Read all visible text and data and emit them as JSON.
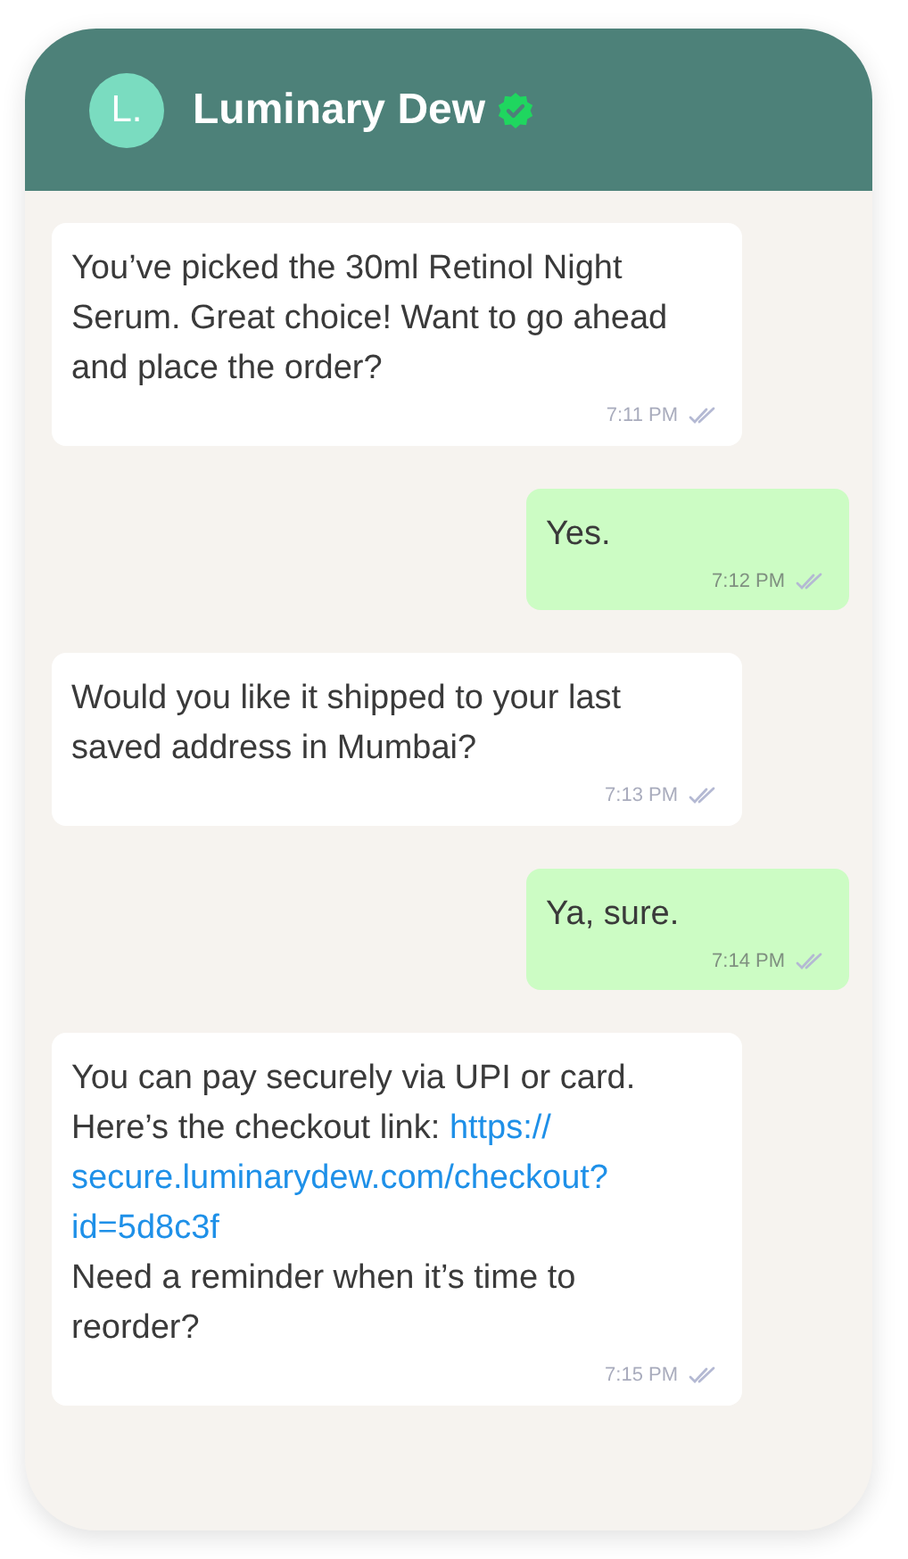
{
  "header": {
    "avatar_initial": "L.",
    "name": "Luminary Dew",
    "verified": true
  },
  "messages": [
    {
      "kind": "incoming",
      "parts": [
        {
          "kind": "text",
          "text": "You’ve picked the 30ml Retinol Night Serum. Great choice! Want to go ahead and place the order?"
        }
      ],
      "time": "7:11 PM",
      "read": true
    },
    {
      "kind": "outgoing",
      "parts": [
        {
          "kind": "text",
          "text": "Yes."
        }
      ],
      "time": "7:12 PM",
      "read": true
    },
    {
      "kind": "incoming",
      "parts": [
        {
          "kind": "text",
          "text": "Would you like it shipped to your last saved address in Mumbai?"
        }
      ],
      "time": "7:13 PM",
      "read": true
    },
    {
      "kind": "outgoing",
      "parts": [
        {
          "kind": "text",
          "text": "Ya, sure."
        }
      ],
      "time": "7:14 PM",
      "read": true
    },
    {
      "kind": "incoming",
      "parts": [
        {
          "kind": "text",
          "text": "You can pay securely via UPI or card. Here’s the checkout link: "
        },
        {
          "kind": "link",
          "lines": [
            "https://",
            "secure.luminarydew.com/checkout?",
            "id=5d8c3f"
          ]
        },
        {
          "kind": "text",
          "text": "Need a reminder when it’s time to reorder?"
        }
      ],
      "time": "7:15 PM",
      "read": true
    }
  ]
}
